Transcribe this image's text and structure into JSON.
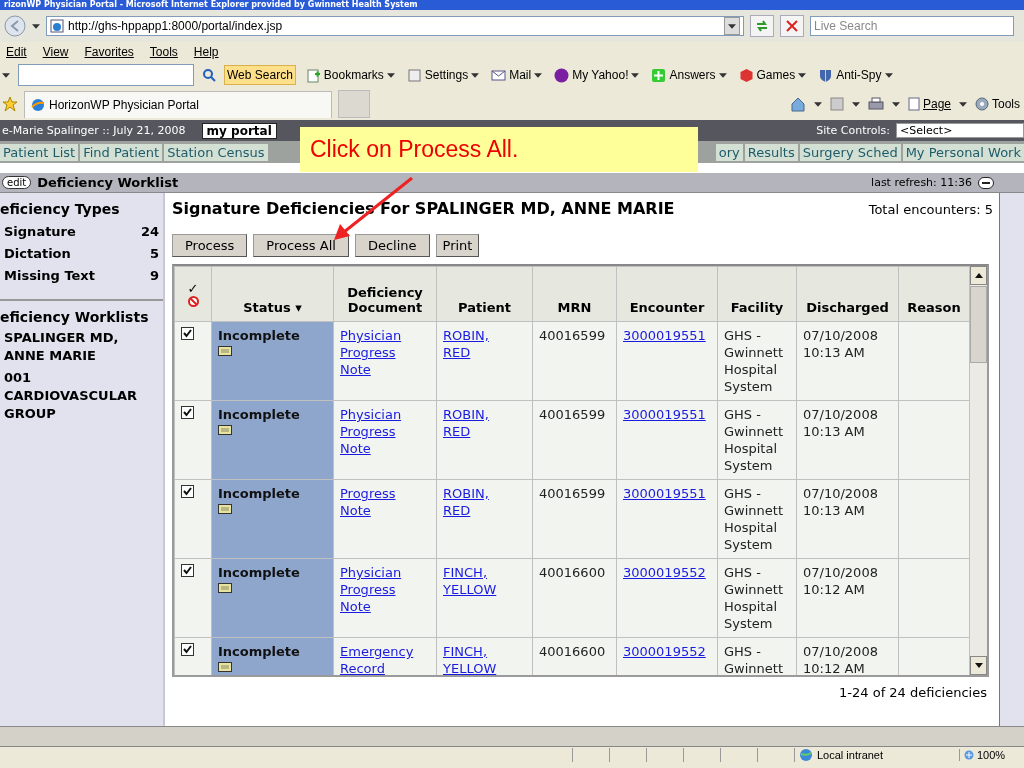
{
  "window": {
    "title": "rizonWP Physician Portal - Microsoft Internet Explorer provided by Gwinnett Health System"
  },
  "address_bar": {
    "url": "http://ghs-hppapp1:8000/portal/index.jsp",
    "search_placeholder": "Live Search"
  },
  "menu": [
    "Edit",
    "View",
    "Favorites",
    "Tools",
    "Help"
  ],
  "toolbar": {
    "search_button": "Web Search",
    "items": [
      {
        "label": "Bookmarks",
        "kind": "bookmarks"
      },
      {
        "label": "Settings",
        "kind": "settings"
      },
      {
        "label": "Mail",
        "kind": "mail"
      },
      {
        "label": "My Yahoo!",
        "kind": "myyahoo"
      },
      {
        "label": "Answers",
        "kind": "answers"
      },
      {
        "label": "Games",
        "kind": "games"
      },
      {
        "label": "Anti-Spy",
        "kind": "antispy"
      }
    ]
  },
  "tabs": [
    {
      "label": "HorizonWP Physician Portal",
      "selected": true
    }
  ],
  "command_bar": {
    "page": "Page",
    "tools": "Tools"
  },
  "portal": {
    "user": "e-Marie Spalinger :: July 21, 2008",
    "portal_tab": "my portal",
    "site_controls_label": "Site Controls:",
    "site_controls_value": "<Select>"
  },
  "nav": {
    "left": [
      "Patient List",
      "Find Patient",
      "Station Census"
    ],
    "right": [
      "ory",
      "Results",
      "Surgery Sched",
      "My Personal Work"
    ]
  },
  "callout": "Click on Process All.",
  "worklist": {
    "edit": "edit",
    "title": "Deficiency Worklist",
    "last_refresh": "last refresh: 11:36"
  },
  "sidebar": {
    "types_heading": "eficiency Types",
    "types": [
      {
        "label": "Signature",
        "count": "24"
      },
      {
        "label": "Dictation",
        "count": "5"
      },
      {
        "label": "Missing Text",
        "count": "9"
      }
    ],
    "worklists_heading": "eficiency Worklists",
    "worklists": [
      "SPALINGER MD, ANNE MARIE",
      "001 CARDIOVASCULAR GROUP"
    ]
  },
  "main": {
    "title": "Signature Deficiencies For SPALINGER MD, ANNE MARIE",
    "total": "Total encounters: 5",
    "buttons": [
      "Process",
      "Process All",
      "Decline",
      "Print"
    ],
    "select_header": "✓",
    "columns": [
      {
        "label": "Status",
        "sort_mark": "▾"
      },
      {
        "label": "Deficiency Document"
      },
      {
        "label": "Patient"
      },
      {
        "label": "MRN"
      },
      {
        "label": "Encounter"
      },
      {
        "label": "Facility"
      },
      {
        "label": "Discharged"
      },
      {
        "label": "Reason"
      }
    ],
    "rows": [
      {
        "checked": true,
        "status": "Incomplete",
        "document": "Physician Progress Note",
        "patient": "ROBIN, RED",
        "mrn": "40016599",
        "encounter": "3000019551",
        "facility": "GHS - Gwinnett Hospital System",
        "discharged": "07/10/2008 10:13 AM"
      },
      {
        "checked": true,
        "status": "Incomplete",
        "document": "Physician Progress Note",
        "patient": "ROBIN, RED",
        "mrn": "40016599",
        "encounter": "3000019551",
        "facility": "GHS - Gwinnett Hospital System",
        "discharged": "07/10/2008 10:13 AM"
      },
      {
        "checked": true,
        "status": "Incomplete",
        "document": "Progress Note",
        "patient": "ROBIN, RED",
        "mrn": "40016599",
        "encounter": "3000019551",
        "facility": "GHS - Gwinnett Hospital System",
        "discharged": "07/10/2008 10:13 AM"
      },
      {
        "checked": true,
        "status": "Incomplete",
        "document": "Physician Progress Note",
        "patient": "FINCH, YELLOW",
        "mrn": "40016600",
        "encounter": "3000019552",
        "facility": "GHS - Gwinnett Hospital System",
        "discharged": "07/10/2008 10:12 AM"
      },
      {
        "checked": true,
        "status": "Incomplete",
        "document": "Emergency Record",
        "patient": "FINCH, YELLOW",
        "mrn": "40016600",
        "encounter": "3000019552",
        "facility": "GHS - Gwinnett",
        "discharged": "07/10/2008 10:12 AM"
      }
    ],
    "footer": "1-24 of 24 deficiencies"
  },
  "status_bar": {
    "zone": "Local intranet",
    "zoom": "100%"
  }
}
